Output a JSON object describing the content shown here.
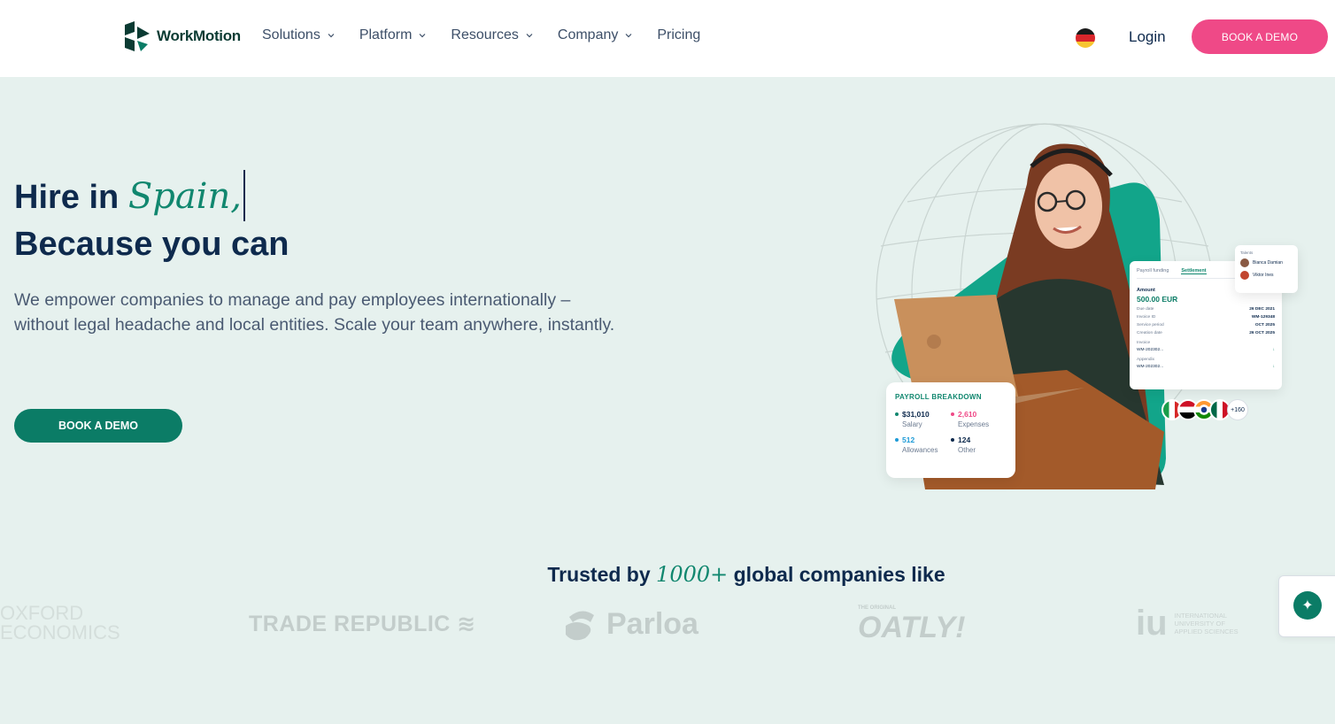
{
  "brand": {
    "name": "WorkMotion"
  },
  "nav": {
    "items": [
      {
        "label": "Solutions",
        "dropdown": true
      },
      {
        "label": "Platform",
        "dropdown": true
      },
      {
        "label": "Resources",
        "dropdown": true
      },
      {
        "label": "Company",
        "dropdown": true
      },
      {
        "label": "Pricing",
        "dropdown": false
      }
    ],
    "language_flag": "de-flag-icon",
    "login_label": "Login",
    "cta_label": "BOOK A DEMO"
  },
  "hero": {
    "headline_prefix": "Hire in ",
    "headline_country": "Spain,",
    "headline_line2": "Because you can",
    "subtitle": "We empower companies to manage and pay employees internationally – without legal headache and local entities. Scale your team anywhere, instantly.",
    "cta_label": "BOOK A DEMO"
  },
  "payroll_card": {
    "title": "PAYROLL BREAKDOWN",
    "items": [
      {
        "value": "$31,010",
        "label": "Salary",
        "color": "#11876f"
      },
      {
        "value": "2,610",
        "label": "Expenses",
        "color": "#ef4987"
      },
      {
        "value": "512",
        "label": "Allowances",
        "color": "#1e9bd7"
      },
      {
        "value": "124",
        "label": "Other",
        "color": "#0e2a4d"
      }
    ]
  },
  "settlement_card": {
    "tab_1": "Payroll funding",
    "tab_2": "Settlement",
    "amount_label": "Amount",
    "amount": "500.00 EUR",
    "rows": [
      {
        "label": "Due date",
        "value": "26 DEC 2021"
      },
      {
        "label": "Invoice ID",
        "value": "WM-129348"
      },
      {
        "label": "Service period",
        "value": "OCT 2025"
      },
      {
        "label": "Creation date",
        "value": "26 OCT 2025"
      }
    ],
    "invoice_label": "Invoice",
    "invoice_file": "WM-202302...",
    "appendix_label": "Appendix",
    "appendix_file": "WM-202302..."
  },
  "talent_card": {
    "title": "Talents",
    "people": [
      "Bianca Damian",
      "Viktor Ines"
    ]
  },
  "flags_more": "+160",
  "trusted": {
    "prefix": "Trusted by ",
    "count": "1000+",
    "suffix": " global companies like"
  },
  "logos": {
    "oxford_line1": "OXFORD",
    "oxford_line2": "ECONOMICS",
    "trade": "TRADE REPUBLIC ≋",
    "parloa": "Parloa",
    "oatly_small": "THE ORIGINAL",
    "oatly": "OATLY!",
    "iu_big": "iu",
    "iu_l1": "INTERNATIONAL",
    "iu_l2": "UNIVERSITY OF",
    "iu_l3": "APPLIED SCIENCES"
  },
  "colors": {
    "accent_green": "#0b7c66",
    "accent_pink": "#ef4987",
    "hero_bg": "#e6f1ee",
    "navy": "#0e2a4d"
  }
}
